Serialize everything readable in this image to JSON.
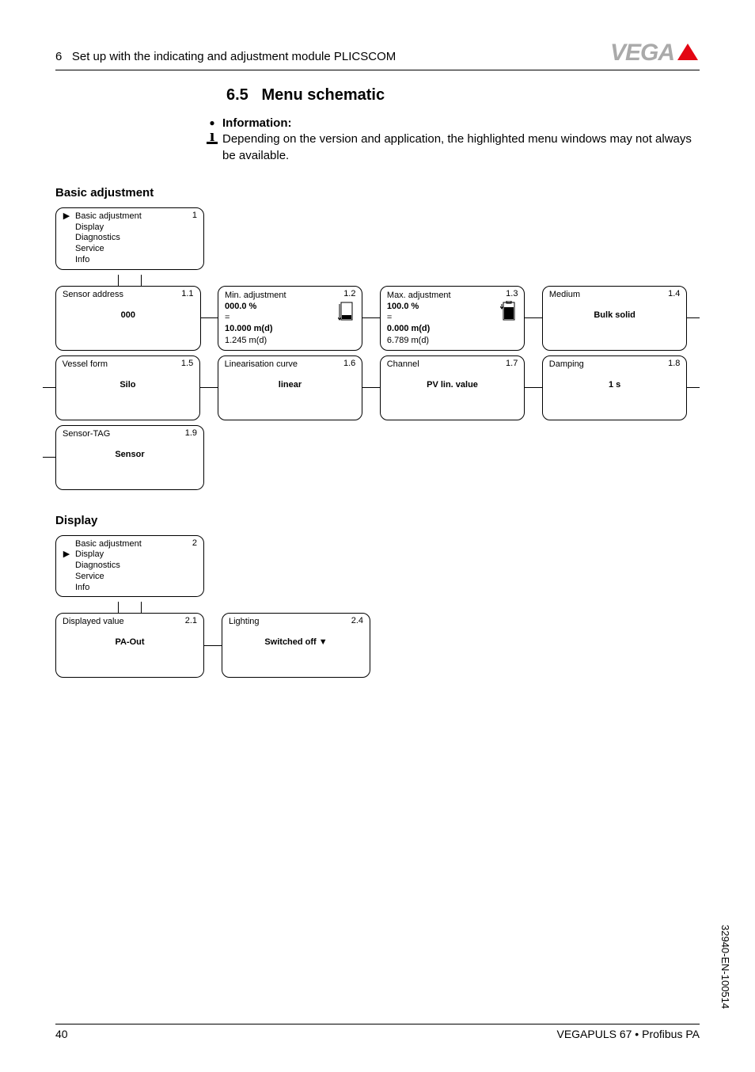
{
  "header": {
    "chapter_num": "6",
    "chapter_title": "Set up with the indicating and adjustment module PLICSCOM",
    "brand": "VEGA"
  },
  "section": {
    "number": "6.5",
    "title": "Menu schematic"
  },
  "info": {
    "heading": "Information:",
    "body": "Depending on the version and application, the highlighted menu windows may not always be available."
  },
  "basic_adjustment": {
    "heading": "Basic adjustment",
    "menu_box": {
      "num": "1",
      "items": [
        "Basic adjustment",
        "Display",
        "Diagnostics",
        "Service",
        "Info"
      ],
      "selected_index": 0
    },
    "boxes": {
      "b11": {
        "num": "1.1",
        "title": "Sensor address",
        "value": "000"
      },
      "b12": {
        "num": "1.2",
        "title": "Min. adjustment",
        "pct": "000.0 %",
        "eq": "=",
        "dist_bold": "10.000 m(d)",
        "dist": "1.245 m(d)"
      },
      "b13": {
        "num": "1.3",
        "title": "Max. adjustment",
        "pct": "100.0 %",
        "eq": "=",
        "dist_bold": "0.000 m(d)",
        "dist": "6.789 m(d)"
      },
      "b14": {
        "num": "1.4",
        "title": "Medium",
        "value": "Bulk solid"
      },
      "b15": {
        "num": "1.5",
        "title": "Vessel form",
        "value": "Silo"
      },
      "b16": {
        "num": "1.6",
        "title": "Linearisation curve",
        "value": "linear"
      },
      "b17": {
        "num": "1.7",
        "title": "Channel",
        "value": "PV lin. value"
      },
      "b18": {
        "num": "1.8",
        "title": "Damping",
        "value": "1 s"
      },
      "b19": {
        "num": "1.9",
        "title": "Sensor-TAG",
        "value": "Sensor"
      }
    }
  },
  "display_section": {
    "heading": "Display",
    "menu_box": {
      "num": "2",
      "items": [
        "Basic adjustment",
        "Display",
        "Diagnostics",
        "Service",
        "Info"
      ],
      "selected_index": 1
    },
    "boxes": {
      "b21": {
        "num": "2.1",
        "title": "Displayed value",
        "value": "PA-Out"
      },
      "b24": {
        "num": "2.4",
        "title": "Lighting",
        "value": "Switched off ▼"
      }
    }
  },
  "footer": {
    "page": "40",
    "product": "VEGAPULS 67 • Profibus PA",
    "side_code": "32940-EN-100514"
  }
}
